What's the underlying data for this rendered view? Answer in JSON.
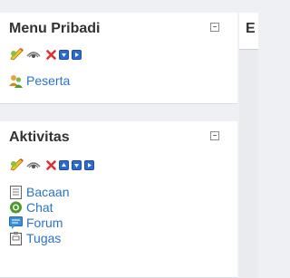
{
  "menu_block": {
    "title": "Menu Pribadi",
    "items": [
      {
        "label": "Peserta",
        "icon": "users-icon"
      }
    ]
  },
  "activity_block": {
    "title": "Aktivitas",
    "items": [
      {
        "label": "Bacaan",
        "icon": "document-icon"
      },
      {
        "label": "Chat",
        "icon": "chat-icon"
      },
      {
        "label": "Forum",
        "icon": "forum-icon"
      },
      {
        "label": "Tugas",
        "icon": "assignment-icon"
      }
    ]
  },
  "side_panel": {
    "title_fragment": "E"
  },
  "colors": {
    "link": "#2a73c6",
    "delete": "#e03131",
    "arrow": "#2a6bd2",
    "page_bg": "#eef0f3"
  }
}
